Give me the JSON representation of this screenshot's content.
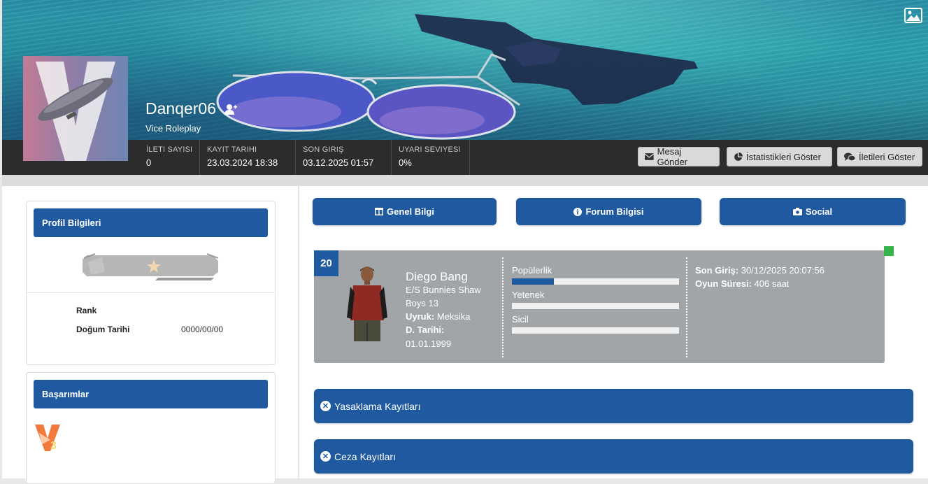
{
  "profile": {
    "username": "Danqer06",
    "group": "Vice Roleplay"
  },
  "stats": [
    {
      "label": "İLETI SAYISI",
      "value": "0"
    },
    {
      "label": "KAYIT TARIHI",
      "value": "23.03.2024 18:38"
    },
    {
      "label": "SON GIRIŞ",
      "value": "03.12.2025 01:57"
    },
    {
      "label": "UYARI SEVIYESI",
      "value": "0%"
    }
  ],
  "actions": {
    "message": "Mesaj Gönder",
    "statistics": "İstatistikleri Göster",
    "posts": "İletileri Göster"
  },
  "profile_card": {
    "title": "Profil Bilgileri",
    "rank_label": "Rank",
    "birth_label": "Doğum Tarihi",
    "birth_value": "0000/00/00"
  },
  "achievements": {
    "title": "Başarımlar"
  },
  "tabs": {
    "general": "Genel Bilgi",
    "forum": "Forum Bilgisi",
    "social": "Social"
  },
  "character": {
    "level": "20",
    "name": "Diego Bang",
    "line1": "E/S Bunnies Shaw",
    "line2": "Boys 13",
    "nationality_label": "Uyruk:",
    "nationality_value": "Meksika",
    "birth_label": "D. Tarihi:",
    "birth_value": "01.01.1999",
    "bars": [
      {
        "label": "Popülerlik",
        "value": 0.25
      },
      {
        "label": "Yetenek",
        "value": 0
      },
      {
        "label": "Sicil",
        "value": 0
      }
    ],
    "last_login_label": "Son Giriş:",
    "last_login_value": "30/12/2025 20:07:56",
    "playtime_label": "Oyun Süresi:",
    "playtime_value": "406 saat"
  },
  "sections": {
    "bans": "Yasaklama Kayıtları",
    "penalties": "Ceza Kayıtları"
  },
  "colors": {
    "primary": "#1f5aa0",
    "statbar": "#2a2c2e",
    "online": "#35b34a",
    "card": "#a2a5a8"
  }
}
